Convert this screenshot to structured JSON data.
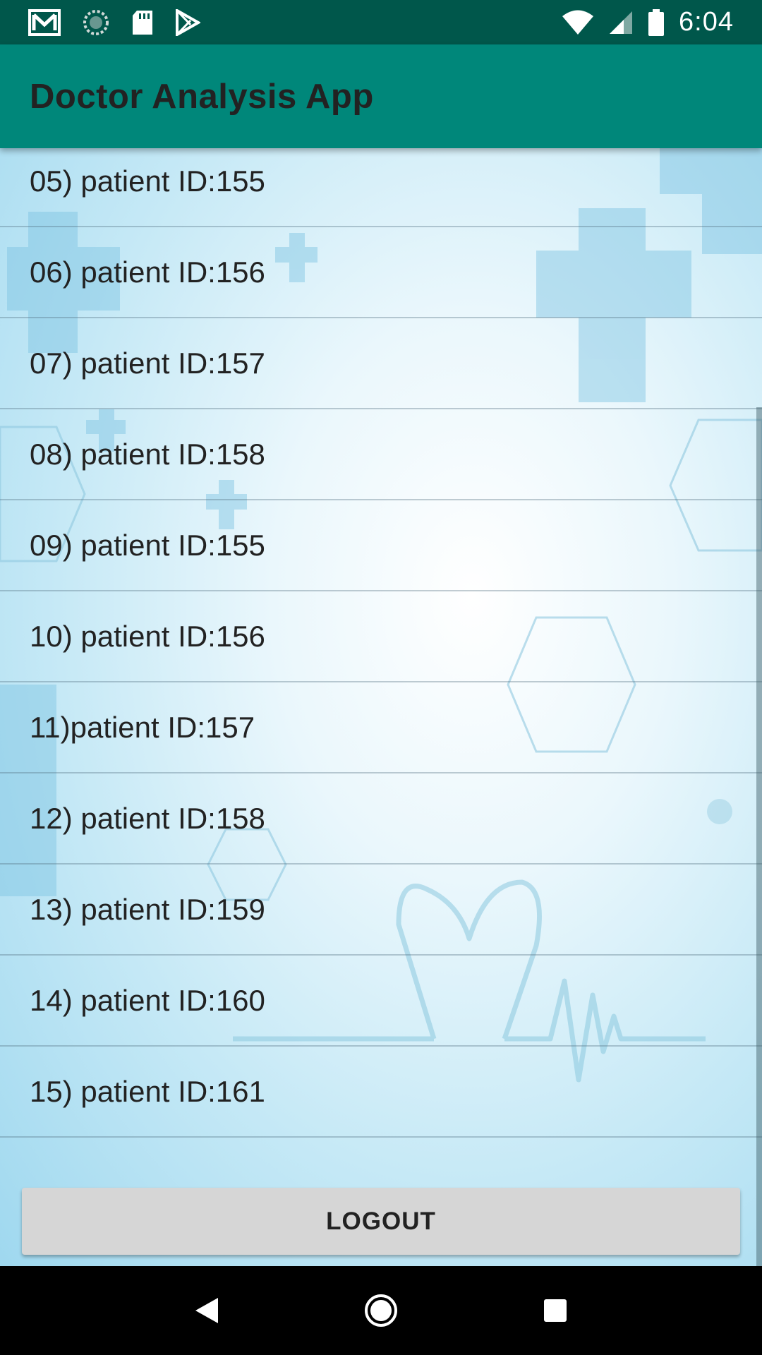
{
  "status_bar": {
    "time": "6:04",
    "left_icons": [
      "gmail-icon",
      "sync-icon",
      "sd-card-icon",
      "play-store-icon"
    ],
    "right_icons": [
      "wifi-icon",
      "cell-signal-icon",
      "battery-icon"
    ]
  },
  "app_bar": {
    "title": "Doctor Analysis App",
    "color": "#00877a"
  },
  "patients": [
    {
      "label": "05) patient ID:155"
    },
    {
      "label": "06) patient ID:156"
    },
    {
      "label": "07) patient ID:157"
    },
    {
      "label": "08) patient ID:158"
    },
    {
      "label": "09) patient ID:155"
    },
    {
      "label": "10) patient ID:156"
    },
    {
      "label": "11)patient ID:157"
    },
    {
      "label": "12) patient ID:158"
    },
    {
      "label": "13) patient ID:159"
    },
    {
      "label": "14) patient ID:160"
    },
    {
      "label": "15) patient ID:161"
    }
  ],
  "logout": {
    "label": "LOGOUT"
  },
  "nav_bar": {
    "icons": [
      "back-icon",
      "home-icon",
      "recents-icon"
    ]
  }
}
